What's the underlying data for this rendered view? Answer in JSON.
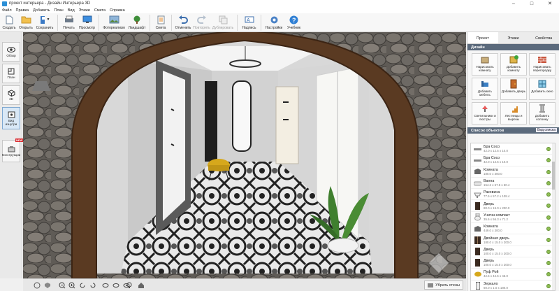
{
  "window": {
    "title": "проект интерьера - Дизайн Интерьера 3D",
    "minimize": "–",
    "maximize": "□",
    "close": "✕"
  },
  "menu": [
    "Файл",
    "Правка",
    "Добавить",
    "План",
    "Вид",
    "Этажи",
    "Смета",
    "Справка"
  ],
  "toolbar": [
    {
      "label": "Создать",
      "icon": "new-file-icon",
      "enabled": true
    },
    {
      "label": "Открыть",
      "icon": "open-folder-icon",
      "enabled": true
    },
    {
      "label": "Сохранить",
      "icon": "save-icon",
      "enabled": true
    },
    {
      "label": "Печать",
      "icon": "printer-icon",
      "enabled": true
    },
    {
      "label": "Просмотр",
      "icon": "monitor-icon",
      "enabled": true
    },
    {
      "label": "Фотореализм",
      "icon": "photo-icon",
      "enabled": true
    },
    {
      "label": "Ландшафт",
      "icon": "tree-icon",
      "enabled": true
    },
    {
      "label": "Смета",
      "icon": "estimate-icon",
      "enabled": true
    },
    {
      "label": "Отменить",
      "icon": "undo-icon",
      "enabled": true
    },
    {
      "label": "Повторить",
      "icon": "redo-icon",
      "enabled": false
    },
    {
      "label": "Дублировать",
      "icon": "duplicate-icon",
      "enabled": false
    },
    {
      "label": "Надпись",
      "icon": "text-label-icon",
      "enabled": true
    },
    {
      "label": "Настройки",
      "icon": "gear-icon",
      "enabled": true
    },
    {
      "label": "Учебник",
      "icon": "help-icon",
      "enabled": true
    }
  ],
  "left": [
    {
      "label": "Обзор",
      "icon": "eye-icon",
      "active": false
    },
    {
      "label": "План",
      "icon": "plan-icon",
      "active": false
    },
    {
      "label": "3D",
      "icon": "3d-icon",
      "active": false
    },
    {
      "label": "Вид изнутри",
      "icon": "inside-view-icon",
      "active": true
    },
    {
      "label": "Конструкции",
      "icon": "constructor-icon",
      "active": false,
      "badge": "NEW"
    }
  ],
  "bottom": {
    "hide_walls": "Убрать стены"
  },
  "panel": {
    "tabs": [
      "Проект",
      "Этажи",
      "Свойства"
    ],
    "active_tab": 0,
    "design_title": "Дизайн",
    "design_buttons": [
      {
        "label": "Нарисовать комнату",
        "icon": "draw-room-icon"
      },
      {
        "label": "Добавить комнату",
        "icon": "add-room-icon"
      },
      {
        "label": "Нарисовать перегородку",
        "icon": "wall-icon"
      },
      {
        "label": "Добавить мебель",
        "icon": "furniture-icon"
      },
      {
        "label": "Добавить дверь",
        "icon": "door-icon"
      },
      {
        "label": "Добавить окно",
        "icon": "window-icon"
      },
      {
        "label": "Светильники и люстры",
        "icon": "lamp-icon"
      },
      {
        "label": "Лестницы и вырезы",
        "icon": "stairs-icon"
      },
      {
        "label": "Добавить колонну",
        "icon": "column-icon"
      }
    ],
    "list_title": "Список объектов",
    "view_label": "Вид списка",
    "objects": [
      {
        "name": "Бра Coco",
        "dims": "42.0 x 12.5 x 10.0",
        "icon": "sconce-icon"
      },
      {
        "name": "Бра Coco",
        "dims": "42.0 x 12.5 x 10.0",
        "icon": "sconce-icon"
      },
      {
        "name": "Комната",
        "dims": "180.0 x 300.0",
        "icon": "room-icon"
      },
      {
        "name": "Ванна",
        "dims": "154.2 x 67.5 x 50.4",
        "icon": "bath-icon"
      },
      {
        "name": "Раковина",
        "dims": "77.5 x 57.2 x 108.4",
        "icon": "sink-icon"
      },
      {
        "name": "Дверь",
        "dims": "80.0 x 15.0 x 200.0",
        "icon": "door-item-icon"
      },
      {
        "name": "Унитаз компакт",
        "dims": "35.6 x 56.3 x 71.2",
        "icon": "toilet-icon"
      },
      {
        "name": "Комната",
        "dims": "449.0 x 300.0",
        "icon": "room-icon"
      },
      {
        "name": "Двойная дверь",
        "dims": "180.0 x 15.0 x 200.0",
        "icon": "double-door-icon"
      },
      {
        "name": "Дверь",
        "dims": "100.0 x 15.0 x 200.0",
        "icon": "door-item-icon"
      },
      {
        "name": "Дверь",
        "dims": "100.0 x 15.0 x 200.0",
        "icon": "door-item-icon"
      },
      {
        "name": "Пуф Рой",
        "dims": "42.5 x 42.5 x 45.0",
        "icon": "pouf-icon"
      },
      {
        "name": "Зеркало",
        "dims": "60.0 x 1.0 x 180.0",
        "icon": "mirror-icon"
      }
    ]
  },
  "colors": {
    "section_header": "#5b6a7c",
    "active_left": "#d9e8f6",
    "wood": "#5a3a22",
    "stone": "#6a6661",
    "pouf": "#d6a81c"
  }
}
